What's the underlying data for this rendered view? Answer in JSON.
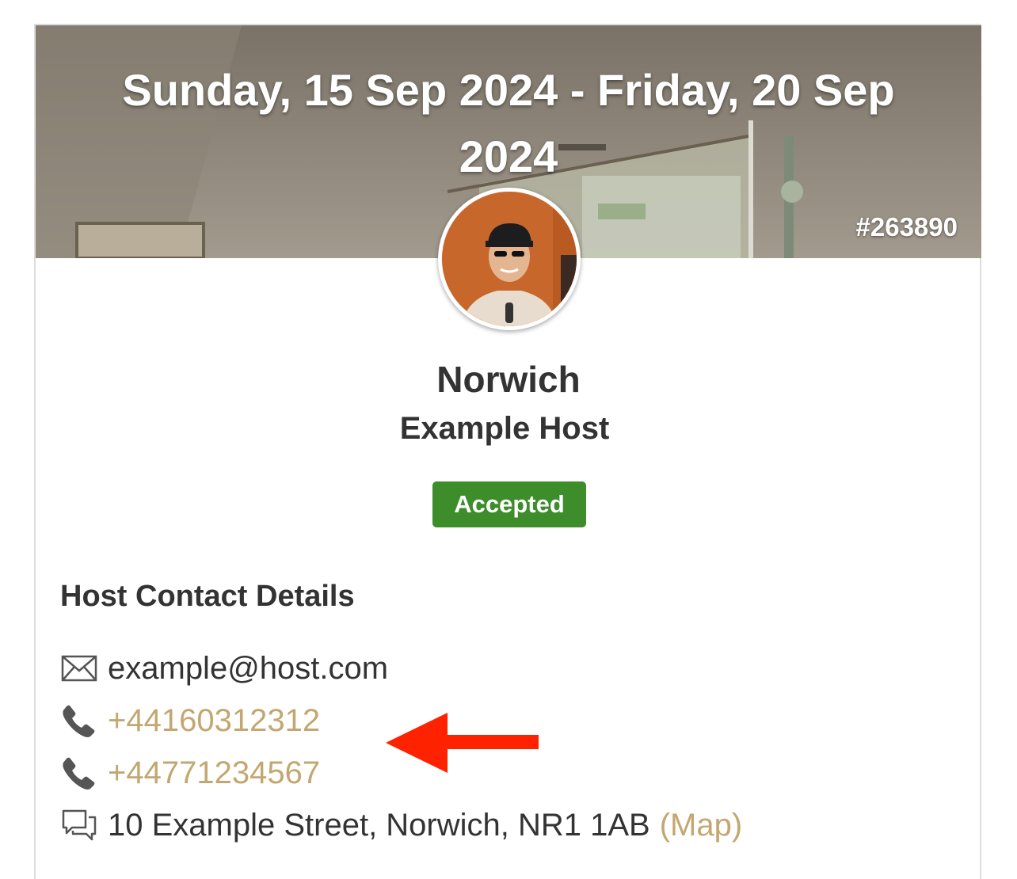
{
  "booking": {
    "date_range": "Sunday, 15 Sep 2024 - Friday, 20 Sep 2024",
    "reference": "#263890",
    "city": "Norwich",
    "host_name": "Example Host",
    "status": "Accepted",
    "status_color": "#3d8d2a"
  },
  "contact": {
    "section_title": "Host Contact Details",
    "email": "example@host.com",
    "phones": [
      "+44160312312",
      "+44771234567"
    ],
    "address": "10 Example Street, Norwich, NR1 1AB",
    "map_link": "(Map)",
    "link_color": "#c3a771"
  },
  "icons": {
    "email": "envelope-icon",
    "phone": "phone-icon",
    "address": "speech-bubbles-icon",
    "annotation": "red-arrow-icon"
  }
}
